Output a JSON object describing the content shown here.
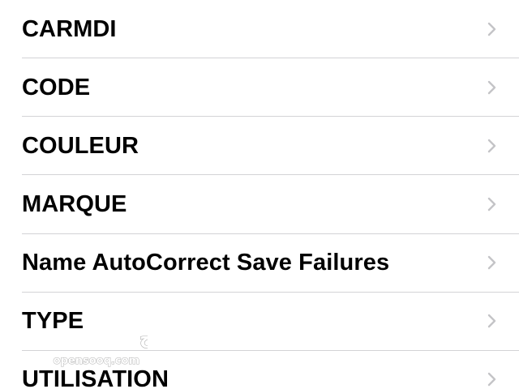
{
  "settings_list": {
    "items": [
      {
        "label": "CARMDI"
      },
      {
        "label": "CODE"
      },
      {
        "label": "COULEUR"
      },
      {
        "label": "MARQUE"
      },
      {
        "label": "Name AutoCorrect Save Failures"
      },
      {
        "label": "TYPE"
      },
      {
        "label": "UTILISATION"
      }
    ]
  },
  "watermark": {
    "arabic_text": "السوق المفتوح",
    "latin_text": "opensooq.com"
  },
  "colors": {
    "text": "#000000",
    "chevron": "#c4c4c7",
    "divider": "#d3d3d6",
    "background": "#ffffff"
  },
  "icons": {
    "row_accessory": "chevron-right-icon"
  }
}
